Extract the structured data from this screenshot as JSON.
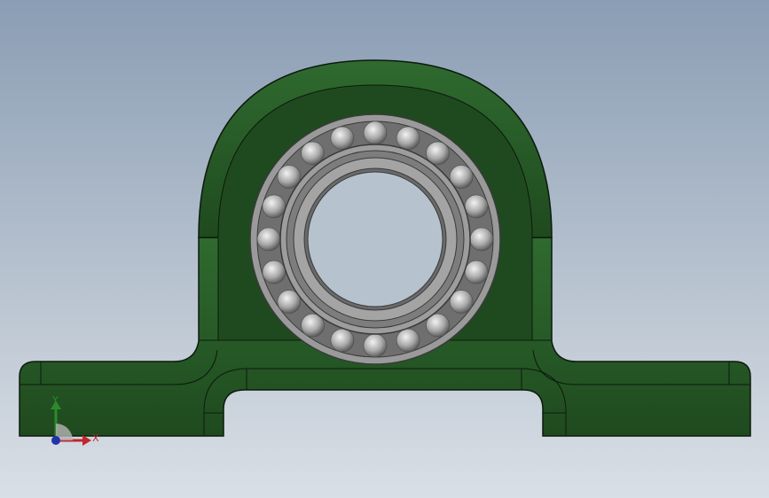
{
  "viewport": {
    "background_top": "#8a9db4",
    "background_bottom": "#d9dfe6"
  },
  "model": {
    "description_icon": "pillow-block-bearing-icon",
    "housing_color": "#2b5e2b",
    "housing_dark": "#1c3f1c",
    "edge_color": "#0d1a0d",
    "bearing_ring_color": "#8a8a8a",
    "ball_color": "#c9c9c9",
    "ball_count": 20
  },
  "triad": {
    "x_label": "X",
    "y_label": "Y",
    "x_color": "#c0262a",
    "y_color": "#2c8a2c",
    "z_color": "#2233aa"
  }
}
